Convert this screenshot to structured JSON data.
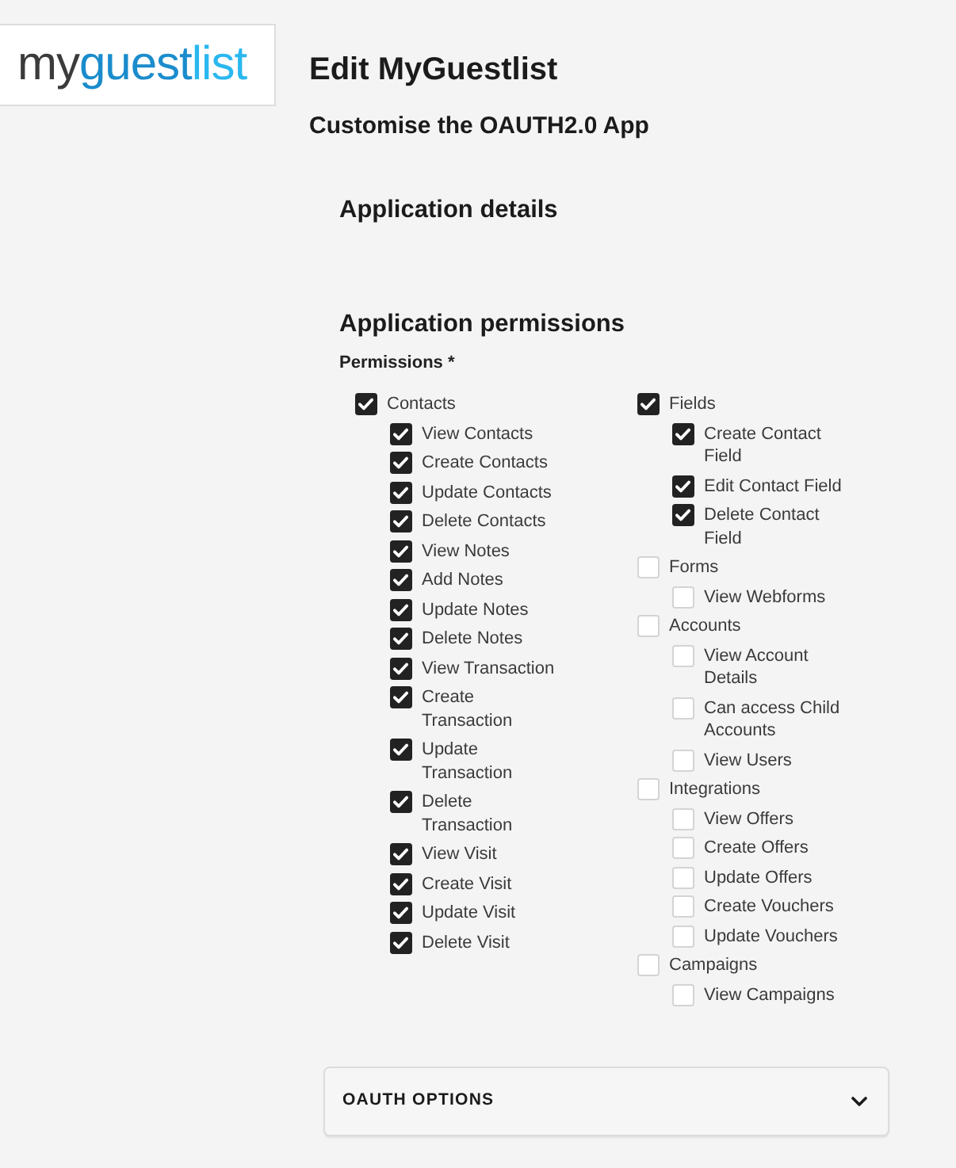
{
  "logo": {
    "parts": [
      "my",
      "guest",
      "list"
    ]
  },
  "page": {
    "title": "Edit MyGuestlist",
    "subtitle": "Customise the OAUTH2.0 App"
  },
  "sections": [
    {
      "heading": "Application details"
    },
    {
      "heading": "Application permissions"
    }
  ],
  "permissions": {
    "label": "Permissions *",
    "columns": [
      [
        {
          "label": "Contacts",
          "checked": true,
          "children": [
            {
              "label": "View Contacts",
              "checked": true
            },
            {
              "label": "Create Contacts",
              "checked": true
            },
            {
              "label": "Update Contacts",
              "checked": true
            },
            {
              "label": "Delete Contacts",
              "checked": true
            },
            {
              "label": "View Notes",
              "checked": true
            },
            {
              "label": "Add Notes",
              "checked": true
            },
            {
              "label": "Update Notes",
              "checked": true
            },
            {
              "label": "Delete Notes",
              "checked": true
            },
            {
              "label": "View Transaction",
              "checked": true
            },
            {
              "label": "Create Transaction",
              "checked": true
            },
            {
              "label": "Update Transaction",
              "checked": true
            },
            {
              "label": "Delete Transaction",
              "checked": true
            },
            {
              "label": "View Visit",
              "checked": true
            },
            {
              "label": "Create Visit",
              "checked": true
            },
            {
              "label": "Update Visit",
              "checked": true
            },
            {
              "label": "Delete Visit",
              "checked": true
            }
          ]
        }
      ],
      [
        {
          "label": "Fields",
          "checked": true,
          "children": [
            {
              "label": "Create Contact Field",
              "checked": true
            },
            {
              "label": "Edit Contact Field",
              "checked": true
            },
            {
              "label": "Delete Contact Field",
              "checked": true
            }
          ]
        },
        {
          "label": "Forms",
          "checked": false,
          "children": [
            {
              "label": "View Webforms",
              "checked": false
            }
          ]
        },
        {
          "label": "Accounts",
          "checked": false,
          "children": [
            {
              "label": "View Account Details",
              "checked": false
            },
            {
              "label": "Can access Child Accounts",
              "checked": false
            },
            {
              "label": "View Users",
              "checked": false
            }
          ]
        },
        {
          "label": "Integrations",
          "checked": false,
          "children": [
            {
              "label": "View Offers",
              "checked": false
            },
            {
              "label": "Create Offers",
              "checked": false
            },
            {
              "label": "Update Offers",
              "checked": false
            },
            {
              "label": "Create Vouchers",
              "checked": false
            },
            {
              "label": "Update Vouchers",
              "checked": false
            }
          ]
        },
        {
          "label": "Campaigns",
          "checked": false,
          "children": [
            {
              "label": "View Campaigns",
              "checked": false
            }
          ]
        }
      ]
    ]
  },
  "accordion": {
    "title": "OAUTH OPTIONS",
    "expanded": false
  }
}
